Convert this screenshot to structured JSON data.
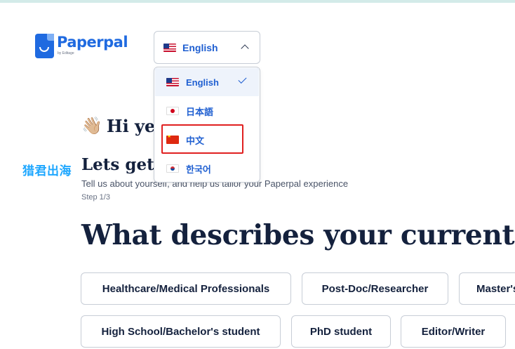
{
  "brand": {
    "name": "Paperpal",
    "sub": "by Editage",
    "color": "#1f6ae0"
  },
  "language_select": {
    "current": "English",
    "current_flag": "us-flag-icon"
  },
  "language_options": [
    {
      "label": "English",
      "flag": "us-flag-icon",
      "selected": true
    },
    {
      "label": "日本語",
      "flag": "jp-flag-icon",
      "selected": false
    },
    {
      "label": "中文",
      "flag": "cn-flag-icon",
      "selected": false,
      "highlighted": true
    },
    {
      "label": "한국어",
      "flag": "kr-flag-icon",
      "selected": false
    }
  ],
  "watermark": "猎君出海",
  "greeting": {
    "icon": "👋🏼",
    "text": "Hi ye"
  },
  "heading": "Lets get",
  "subtitle": "Tell us about yourself, and help us tailor your Paperpal experience",
  "step": "Step 1/3",
  "question": "What describes your current ro",
  "roles_row1": [
    "Healthcare/Medical Professionals",
    "Post-Doc/Researcher",
    "Master's"
  ],
  "roles_row2": [
    "High School/Bachelor's student",
    "PhD student",
    "Editor/Writer"
  ],
  "colors": {
    "accent": "#1f5fd1",
    "text_dark": "#14213d",
    "highlight": "#e02020",
    "border": "#c7cdd6"
  }
}
